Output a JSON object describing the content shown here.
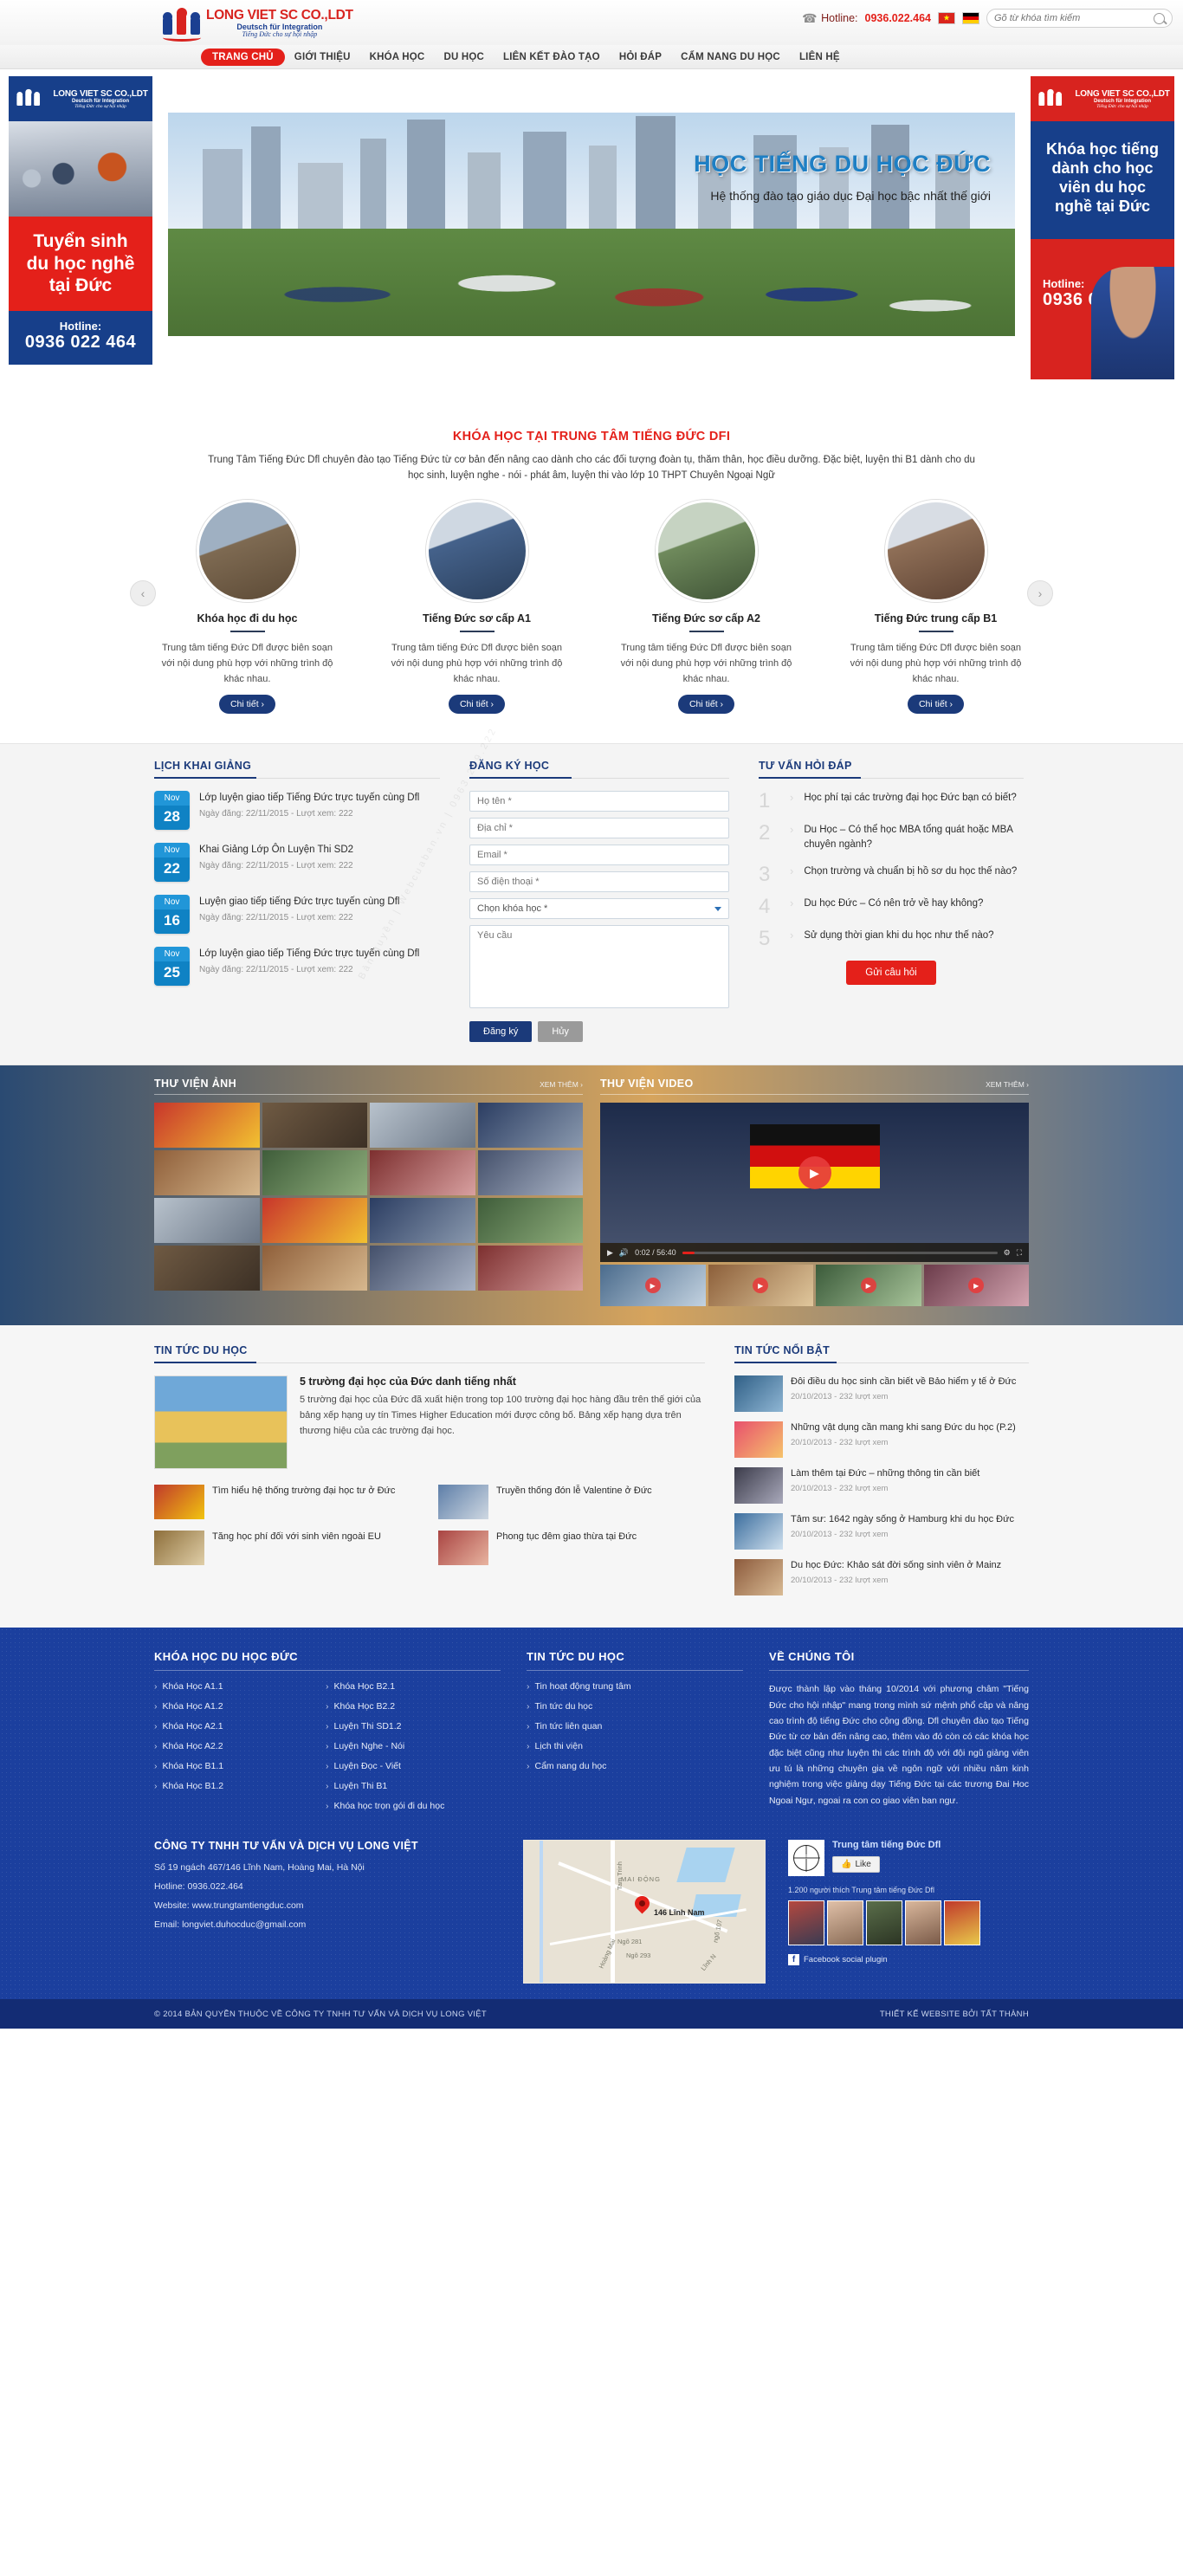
{
  "topbar": {
    "logo": {
      "title": "LONG VIET SC CO.,LDT",
      "sub": "Deutsch für Integration",
      "sub2": "Tiếng Đức cho sự hội nhập"
    },
    "phone_icon": "phone-icon",
    "hotline_label": "Hotline:",
    "hotline_number": "0936.022.464",
    "flags": [
      "flag-vietnam",
      "flag-germany"
    ],
    "search_placeholder": "Gõ từ khóa tìm kiếm",
    "search_value": ""
  },
  "nav": {
    "items": [
      {
        "label": "TRANG CHỦ",
        "active": true
      },
      {
        "label": "GIỚI THIỆU",
        "active": false
      },
      {
        "label": "KHÓA HỌC",
        "active": false
      },
      {
        "label": "DU HỌC",
        "active": false
      },
      {
        "label": "LIÊN KẾT ĐÀO TẠO",
        "active": false
      },
      {
        "label": "HỎI ĐÁP",
        "active": false
      },
      {
        "label": "CẨM NANG DU HỌC",
        "active": false
      },
      {
        "label": "LIÊN HỆ",
        "active": false
      }
    ]
  },
  "banner_left": {
    "logo_title": "LONG VIET SC CO.,LDT",
    "logo_sub": "Deutsch für Integration",
    "logo_sub2": "Tiếng Đức cho sự hội nhập",
    "line1": "Tuyển sinh",
    "line2": "du học nghề",
    "line3": "tại Đức",
    "hotline_label": "Hotline:",
    "hotline_number": "0936 022 464"
  },
  "banner_right": {
    "logo_title": "LONG VIET SC CO.,LDT",
    "logo_sub": "Deutsch für Integration",
    "logo_sub2": "Tiếng Đức cho sự hội nhập",
    "line1": "Khóa học tiếng",
    "line2": "dành cho học",
    "line3": "viên du học",
    "line4": "nghề tại Đức",
    "hotline_label": "Hotline:",
    "hotline_number": "0936 022 464"
  },
  "slider": {
    "title": "HỌC TIẾNG DU HỌC ĐỨC",
    "subtitle": "Hệ thống đào tạo giáo dục Đại học bậc nhất thế giới",
    "prev_icon": "chevron-left-icon",
    "next_icon": "chevron-right-icon"
  },
  "courses_section": {
    "title": "KHÓA HỌC TẠI TRUNG TÂM TIẾNG ĐỨC DFI",
    "description": "Trung Tâm Tiếng Đức Dfl chuyên đào tạo Tiếng Đức từ cơ bản đến nâng cao dành cho các đối tượng đoàn tụ, thăm thân, học điều dưỡng. Đặc biệt, luyện thi B1 dành cho du học sinh, luyện nghe - nói - phát âm, luyện thi vào lớp 10 THPT Chuyên Ngoại Ngữ",
    "items": [
      {
        "title": "Khóa học đi du học",
        "desc": "Trung tâm tiếng Đức Dfl được biên soạn với nội dung phù hợp với những trình độ khác nhau.",
        "button": "Chi tiết ›"
      },
      {
        "title": "Tiếng Đức sơ cấp A1",
        "desc": "Trung tâm tiếng Đức Dfl được biên soạn với nội dung phù hợp với những trình độ khác nhau.",
        "button": "Chi tiết ›"
      },
      {
        "title": "Tiếng Đức sơ cấp A2",
        "desc": "Trung tâm tiếng Đức Dfl được biên soạn với nội dung phù hợp với những trình độ khác nhau.",
        "button": "Chi tiết ›"
      },
      {
        "title": "Tiếng Đức trung cấp B1",
        "desc": "Trung tâm tiếng Đức Dfl được biên soạn với nội dung phù hợp với những trình độ khác nhau.",
        "button": "Chi tiết ›"
      }
    ]
  },
  "schedule": {
    "title": "LỊCH KHAI GIẢNG",
    "items": [
      {
        "month": "Nov",
        "day": "28",
        "title": "Lớp luyện giao tiếp Tiếng Đức trực tuyến cùng Dfl",
        "meta": "Ngày đăng: 22/11/2015 - Lượt xem: 222"
      },
      {
        "month": "Nov",
        "day": "22",
        "title": "Khai Giảng Lớp Ôn Luyện Thi SD2",
        "meta": "Ngày đăng: 22/11/2015 - Lượt xem: 222"
      },
      {
        "month": "Nov",
        "day": "16",
        "title": "Luyện giao tiếp tiếng Đức trực tuyến cùng Dfl",
        "meta": "Ngày đăng: 22/11/2015 - Lượt xem: 222"
      },
      {
        "month": "Nov",
        "day": "25",
        "title": "Lớp luyện giao tiếp Tiếng Đức trực tuyến cùng Dfl",
        "meta": "Ngày đăng: 22/11/2015 - Lượt xem: 222"
      }
    ]
  },
  "register": {
    "title": "ĐĂNG KÝ HỌC",
    "fields": [
      {
        "placeholder": "Họ tên *",
        "value": ""
      },
      {
        "placeholder": "Địa chỉ *",
        "value": ""
      },
      {
        "placeholder": "Email *",
        "value": ""
      },
      {
        "placeholder": "Số điện thoại *",
        "value": ""
      }
    ],
    "select_label": "Chọn khóa học *",
    "textarea_placeholder": "Yêu cầu",
    "submit": "Đăng ký",
    "cancel": "Hủy"
  },
  "faq": {
    "title": "TƯ VẤN HỎI ĐÁP",
    "items": [
      {
        "num": "1",
        "q": "Học phí tại các trường đại học Đức bạn có biết?"
      },
      {
        "num": "2",
        "q": "Du Học – Có thể học MBA tổng quát hoặc MBA chuyên ngành?"
      },
      {
        "num": "3",
        "q": "Chọn trường và chuẩn bị hồ sơ du học thế nào?"
      },
      {
        "num": "4",
        "q": "Du học Đức – Có nên trở về hay không?"
      },
      {
        "num": "5",
        "q": "Sử dụng thời gian khi du học như thế nào?"
      }
    ],
    "button": "Gửi câu hỏi"
  },
  "photo_library": {
    "title": "THƯ VIỆN ẢNH",
    "more": "XEM THÊM ›"
  },
  "video_library": {
    "title": "THƯ VIỆN VIDEO",
    "more": "XEM THÊM ›",
    "play_icon": "play-icon",
    "time": "0:02 / 56:40",
    "volume_icon": "volume-icon",
    "settings_icon": "gear-icon",
    "fullscreen_icon": "fullscreen-icon"
  },
  "news": {
    "title": "TIN TỨC DU HỌC",
    "feature": {
      "headline": "5 trường đại học của Đức danh tiếng nhất",
      "body": "5 trường đại học của Đức đã xuất hiện trong top 100 trường đại học hàng đầu trên thế giới của bảng xếp hạng uy tín Times Higher Education  mới được công bố. Bảng xếp hạng dựa trên thương hiệu của các trường đại học."
    },
    "small_items": [
      {
        "title": "Tìm hiểu hệ thống trường đại học tư ở Đức"
      },
      {
        "title": "Truyền thống đón lễ Valentine ở Đức"
      },
      {
        "title": "Tăng học phí đối với sinh viên ngoài EU"
      },
      {
        "title": "Phong tục đêm giao thừa tại Đức"
      }
    ]
  },
  "hot_news": {
    "title": "TIN TỨC NỔI BẬT",
    "items": [
      {
        "title": "Đôi điều du học sinh cần biết về Bảo hiểm y tế ở Đức",
        "meta": "20/10/2013 - 232 lượt xem"
      },
      {
        "title": "Những vật dụng cần mang khi sang Đức du học (P.2)",
        "meta": "20/10/2013 - 232 lượt xem"
      },
      {
        "title": "Làm thêm tại Đức – những thông tin cần biết",
        "meta": "20/10/2013 - 232 lượt xem"
      },
      {
        "title": "Tâm sư: 1642 ngày sống ở Hamburg khi du học Đức",
        "meta": "20/10/2013 - 232 lượt xem"
      },
      {
        "title": "Du học Đức: Khảo sát đời sống sinh viên ở Mainz",
        "meta": "20/10/2013 - 232 lượt xem"
      }
    ]
  },
  "footer": {
    "courses": {
      "title": "KHÓA HỌC DU HỌC ĐỨC",
      "col1": [
        "Khóa Học A1.1",
        "Khóa Học A1.2",
        "Khóa Học A2.1",
        "Khóa Học A2.2",
        "Khóa Học B1.1",
        "Khóa Học B1.2"
      ],
      "col2": [
        "Khóa Học B2.1",
        "Khóa Học B2.2",
        "Luyện Thi SD1.2",
        "Luyện Nghe - Nói",
        "Luyện Đọc - Viết",
        "Luyện Thi B1",
        "Khóa học trọn gói đi du học"
      ]
    },
    "news": {
      "title": "TIN TỨC DU HỌC",
      "items": [
        "Tin hoạt động trung tâm",
        "Tin tức du học",
        "Tin tức liên quan",
        "Lịch thi viện",
        "Cẩm nang du học"
      ]
    },
    "about": {
      "title": "VỀ CHÚNG TÔI",
      "text": "Được thành lập vào tháng 10/2014 với phương châm \"Tiếng Đức cho hội nhập\" mang trong mình sứ mệnh phổ cập và nâng cao trình độ tiếng Đức cho cộng đồng. Dfl chuyên đào tạo Tiếng Đức từ cơ bản đến nâng cao, thêm vào đó còn có các khóa học đặc biệt cũng như luyện thi các trình độ với đội ngũ giảng viên ưu tú là những chuyên gia về ngôn ngữ với nhiều năm kinh nghiệm trong việc giảng dạy Tiếng Đức tại các trương Đai Hoc Ngoai Ngư, ngoai ra con co giao viên ban ngư."
    },
    "contact": {
      "company": "CÔNG TY TNHH TƯ VẤN VÀ DỊCH VỤ LONG VIỆT",
      "address": "Số 19 ngách 467/146 Lĩnh Nam, Hoàng Mai, Hà Nội",
      "hotline": "Hotline: 0936.022.464",
      "website": "Website: www.trungtamtiengduc.com",
      "email": "Email: longviet.duhocduc@gmail.com"
    },
    "map": {
      "pin_label": "146 Lĩnh Nam",
      "labels": [
        "MAI ĐỘNG",
        "Tam Trinh",
        "Ngõ 281",
        "Ngõ 293",
        "Hoàng Mai",
        "Lĩnh N",
        "ngõ 107"
      ]
    },
    "facebook": {
      "page_name": "Trung tâm tiếng Đức Dfl",
      "like_label": "Like",
      "thumb_icon": "thumbs-up-icon",
      "count": "1.200 người thích Trung tâm tiếng Đức Dfl",
      "plugin": "Facebook social plugin",
      "f_icon": "facebook-icon"
    },
    "copyright_left": "© 2014 BẢN QUYỀN THUỘC VỀ CÔNG TY TNHH TƯ VẤN VÀ DỊCH VỤ LONG VIỆT",
    "copyright_right": "THIẾT KẾ WEBSITE BỞI TẤT THÀNH"
  }
}
